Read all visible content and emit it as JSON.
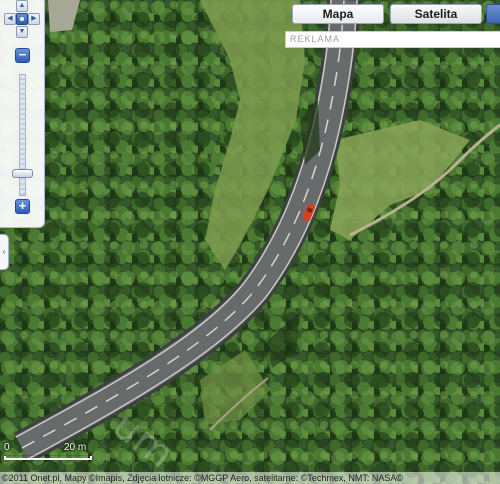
{
  "map": {
    "view": "satellite",
    "features": [
      "road",
      "car",
      "forest",
      "path",
      "meadow"
    ],
    "colors": {
      "forest": "#2e4d21",
      "meadow": "#7e9b4f",
      "road": "#5c5f60",
      "car": "#d94020"
    }
  },
  "navigation": {
    "pan_up_icon": "arrow-up-icon",
    "pan_down_icon": "arrow-down-icon",
    "pan_left_icon": "arrow-left-icon",
    "pan_right_icon": "arrow-right-icon",
    "zoom_in_label": "+",
    "zoom_out_label": "−",
    "zoom_level_fraction": 0.84
  },
  "map_types": {
    "map_label": "Mapa",
    "satellite_label": "Satelita",
    "active": "satellite"
  },
  "ad": {
    "label": "REKLAMA"
  },
  "scale": {
    "zero_label": "0",
    "distance_label": "20 m"
  },
  "watermark": {
    "text": "um"
  },
  "attribution": {
    "text": "©2011 Onet.pl, Mapy ©Imapis, Zdjęcia lotnicze: ©MGGP Aero, satelitarne: ©Techmex, NMT: NASA©"
  }
}
